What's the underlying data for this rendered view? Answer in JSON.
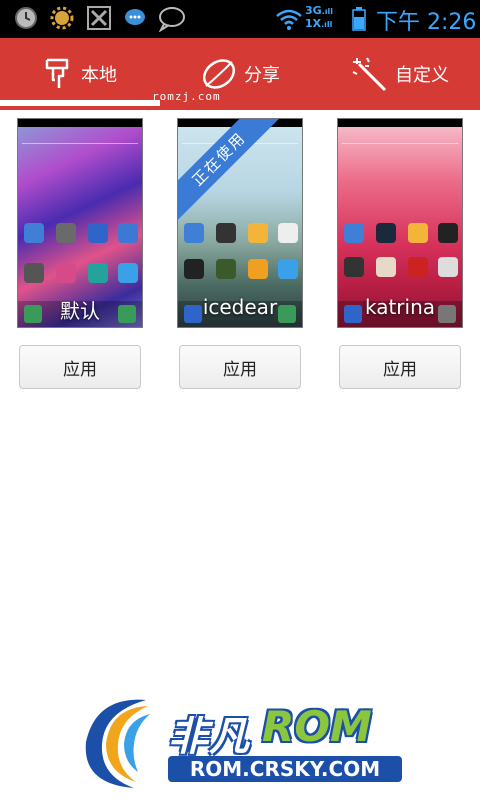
{
  "status_bar": {
    "network": "3G\n1X",
    "time": "下午 2:26",
    "icons": [
      "clock-icon",
      "settings-sun-icon",
      "app-icon",
      "message-icon",
      "chat-icon",
      "wifi-icon",
      "battery-icon"
    ]
  },
  "tabs": [
    {
      "label": "本地",
      "icon": "usb-icon",
      "active": true
    },
    {
      "label": "分享",
      "icon": "leaf-icon",
      "active": false
    },
    {
      "label": "自定义",
      "icon": "magic-wand-icon",
      "active": false
    }
  ],
  "watermark_top": "romzj.com",
  "themes": [
    {
      "name": "默认",
      "in_use": false
    },
    {
      "name": "icedear",
      "in_use": true,
      "ribbon": "正在使用"
    },
    {
      "name": "katrina",
      "in_use": false
    }
  ],
  "apply_label": "应用",
  "logo": {
    "cn": "非凡",
    "rom": "ROM",
    "url": "ROM.CRSKY.COM"
  },
  "colors": {
    "tabbar": "#d63a34",
    "status_text": "#3aa8ff",
    "ribbon": "#3a7bd5"
  }
}
